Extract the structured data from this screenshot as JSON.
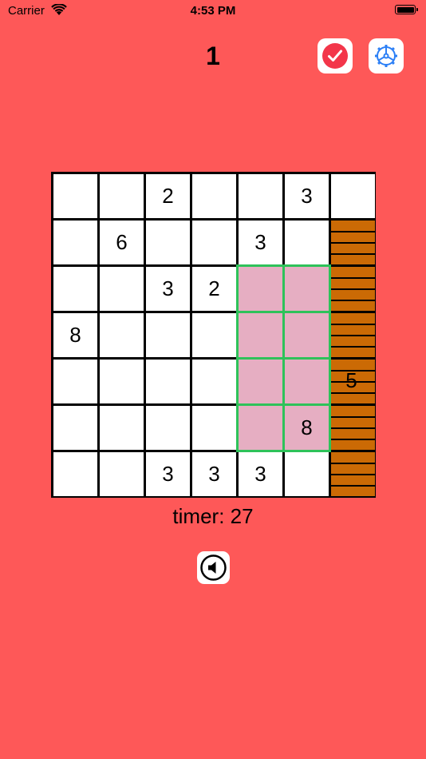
{
  "status": {
    "carrier": "Carrier",
    "time": "4:53 PM"
  },
  "header": {
    "level": "1"
  },
  "board": {
    "rows": [
      [
        "",
        "",
        "2",
        "",
        "",
        "3",
        ""
      ],
      [
        "",
        "6",
        "",
        "",
        "3",
        "",
        ""
      ],
      [
        "",
        "",
        "3",
        "2",
        "",
        "",
        ""
      ],
      [
        "8",
        "",
        "",
        "",
        "",
        "",
        ""
      ],
      [
        "",
        "",
        "",
        "",
        "",
        "",
        ""
      ],
      [
        "",
        "",
        "",
        "",
        "",
        "8",
        ""
      ],
      [
        "",
        "",
        "3",
        "3",
        "3",
        "",
        ""
      ]
    ],
    "wood_clue": "5"
  },
  "timer": {
    "label": "timer: 27"
  },
  "colors": {
    "background": "#fe5858",
    "highlight": "#e6aec2",
    "highlight_border": "#2ec25a",
    "wood": "#cb6a05",
    "check_icon": "#f3364a",
    "gear_icon": "#2b7ff6"
  },
  "icons": {
    "check": "check-circle-icon",
    "settings": "gear-icon",
    "sound": "speaker-icon"
  }
}
